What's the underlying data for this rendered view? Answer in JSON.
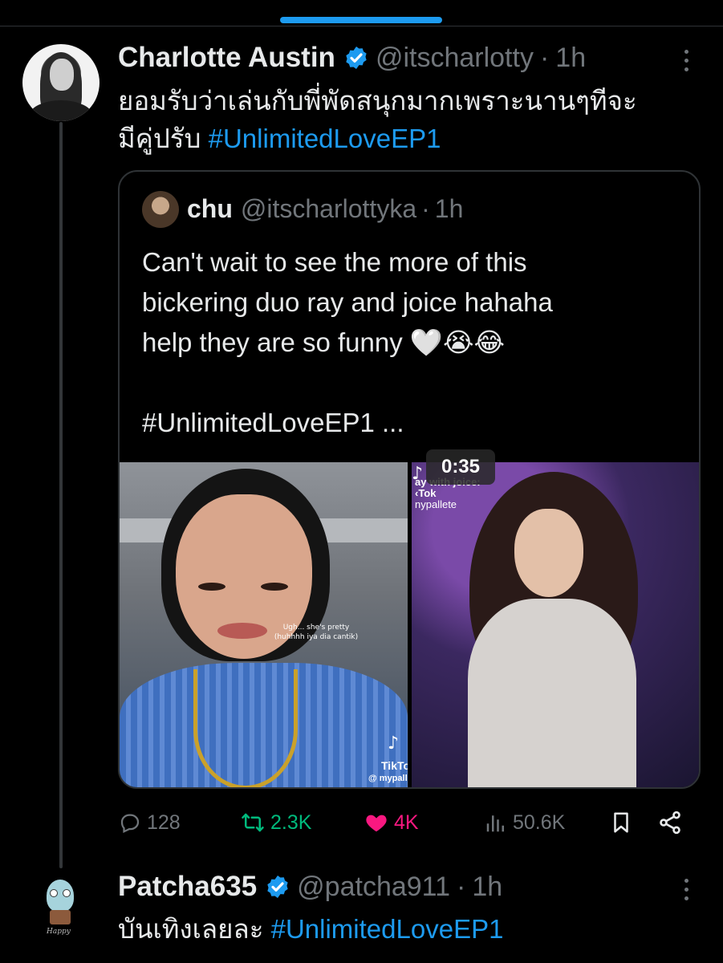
{
  "main_tweet": {
    "author_name": "Charlotte Austin",
    "handle": "@itscharlotty",
    "separator": "·",
    "time": "1h",
    "text_line1": "ยอมรับว่าเล่นกับพี่พัดสนุกมากเพราะนานๆทีจะ",
    "text_line2": "มีคู่ปรับ ",
    "hashtag": "#UnlimitedLoveEP1",
    "quote": {
      "author_name": "chu",
      "handle": "@itscharlottyka",
      "separator": "·",
      "time": "1h",
      "line1": "Can't wait to see the more of this",
      "line2": "bickering duo ray and joice hahaha",
      "line3": "help they are so funny 🤍😭😂",
      "line4": "#UnlimitedLoveEP1 ...",
      "media_left": {
        "caption_line1": "Ugh... she's pretty",
        "caption_line2": "(huhhhh iya dia cantik)",
        "tiktok_label": "TikTo",
        "tiktok_user": "@ mypall"
      },
      "media_right": {
        "caption_line1": "ay with joice:",
        "caption_line2": "‹Tok",
        "caption_line3": "nypallete",
        "duration": "0:35"
      }
    },
    "actions": {
      "replies": "128",
      "retweets": "2.3K",
      "likes": "4K",
      "views": "50.6K"
    }
  },
  "reply_tweet": {
    "author_name": "Patcha635",
    "handle": "@patcha911",
    "separator": "·",
    "time": "1h",
    "text": "บันเทิงเลยละ ",
    "hashtag": "#UnlimitedLoveEP1",
    "avatar_text": "Happy"
  },
  "colors": {
    "background": "#000000",
    "accent": "#1d9bf0",
    "muted": "#71767b",
    "retweet": "#00ba7c",
    "like": "#f91880"
  }
}
